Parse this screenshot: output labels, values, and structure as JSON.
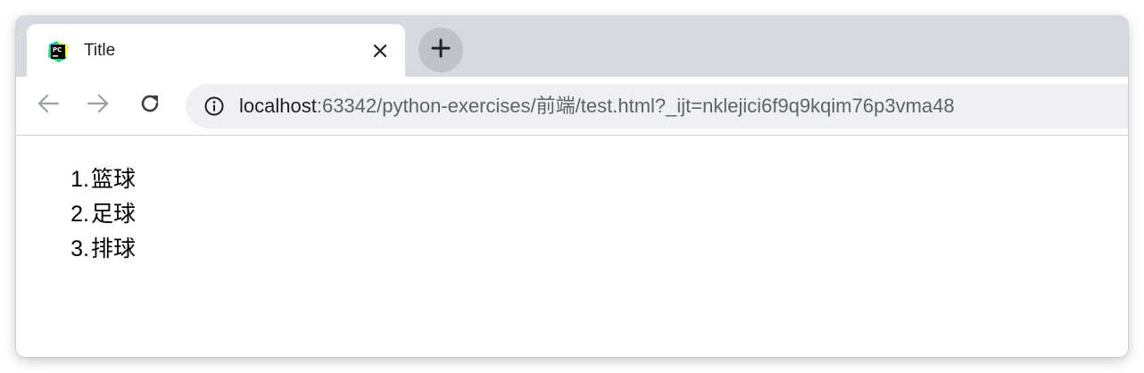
{
  "tab": {
    "title": "Title",
    "favicon": "pycharm-icon"
  },
  "toolbar": {
    "back": "arrow-left-icon",
    "forward": "arrow-right-icon",
    "reload": "reload-icon"
  },
  "address_bar": {
    "host": "localhost",
    "rest": ":63342/python-exercises/前端/test.html?_ijt=nklejici6f9q9kqim76p3vma48",
    "info_icon": "info-icon"
  },
  "page": {
    "list": [
      {
        "number": "1.",
        "text": "篮球"
      },
      {
        "number": "2.",
        "text": "足球"
      },
      {
        "number": "3.",
        "text": "排球"
      }
    ]
  },
  "colors": {
    "tabstrip": "#d6d9e0",
    "omnibox": "#eef0f3",
    "new_tab_button": "#bfc2c9"
  }
}
